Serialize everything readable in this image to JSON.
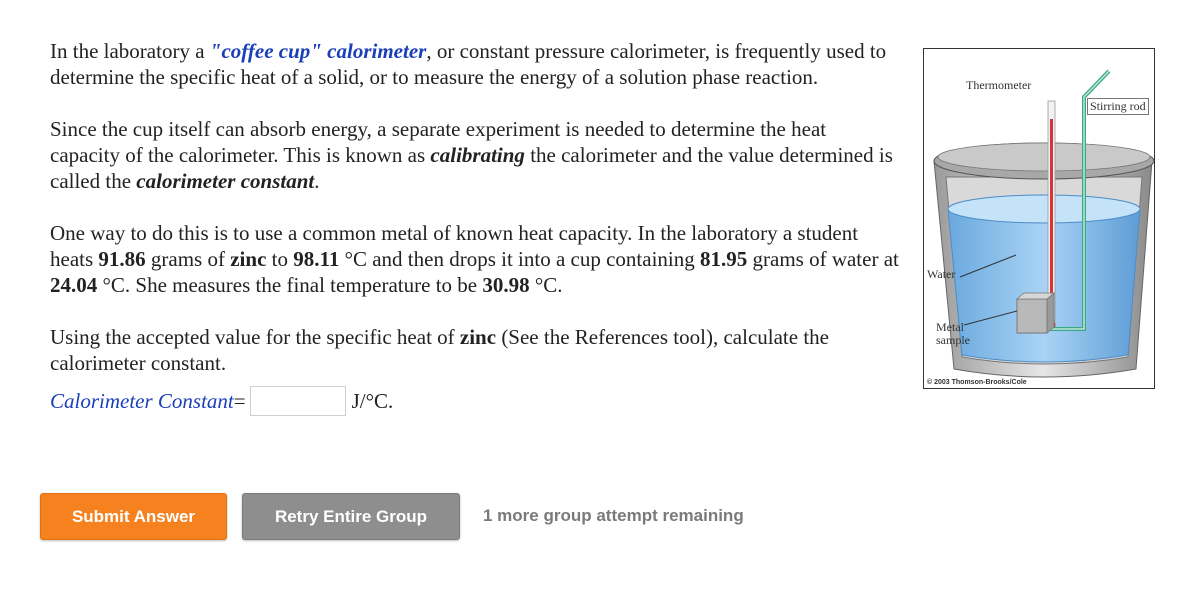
{
  "problem": {
    "p1": {
      "a": "In the laboratory a ",
      "term": "\"coffee cup\" calorimeter",
      "b": ", or constant pressure calorimeter, is frequently used to determine the specific heat of a solid, or to measure the energy of a solution phase reaction."
    },
    "p2": {
      "a": "Since the cup itself can absorb energy, a separate experiment is needed to determine the heat capacity of the calorimeter. This is known as ",
      "term1": "calibrating",
      "b": " the calorimeter and the value determined is called the ",
      "term2": "calorimeter constant",
      "c": "."
    },
    "p3": {
      "a": "One way to do this is to use a common metal of known heat capacity.  In the laboratory a student heats ",
      "mass_metal": "91.86",
      "b": " grams of ",
      "metal": "zinc",
      "c": " to ",
      "temp_metal": "98.11",
      "d": " °C and then drops it into a cup containing ",
      "mass_water": "81.95",
      "e": " grams of water at ",
      "temp_water": "24.04",
      "f": " °C. She measures the final temperature to be ",
      "temp_final": "30.98",
      "g": " °C."
    },
    "p4": {
      "a": "Using the accepted value for the specific heat of ",
      "metal": "zinc",
      "b": " (See the References tool), calculate the calorimeter constant."
    }
  },
  "answer": {
    "label": "Calorimeter Constant",
    "equals": " =",
    "value": "",
    "unit": "J/°C."
  },
  "figure": {
    "thermometer_label": "Thermometer",
    "stirring_rod_label": "Stirring rod",
    "water_label": "Water",
    "metal_label_line1": "Metal",
    "metal_label_line2": "sample",
    "copyright": "© 2003 Thomson-Brooks/Cole"
  },
  "buttons": {
    "submit": "Submit Answer",
    "retry": "Retry Entire Group"
  },
  "attempts_text": "1 more group attempt remaining",
  "colors": {
    "accent_blue": "#1a3fb8",
    "submit_orange": "#f5821f",
    "retry_gray": "#8e8e8e",
    "water_blue": "#8ec3ef",
    "stirring_rod_green": "#3aa884"
  }
}
